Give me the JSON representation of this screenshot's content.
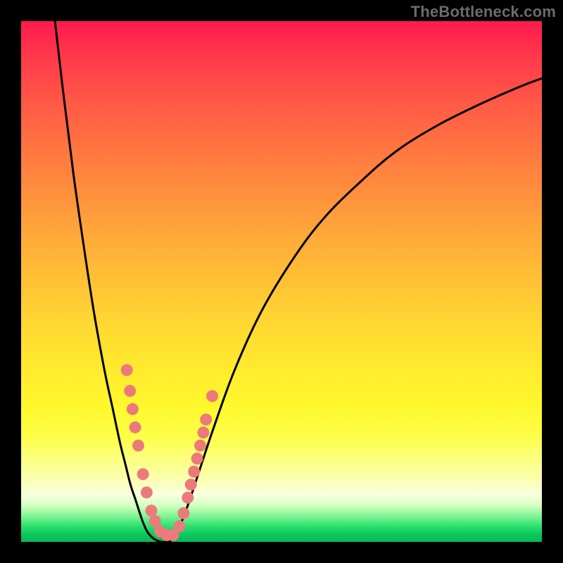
{
  "watermark": "TheBottleneck.com",
  "colors": {
    "frame": "#000000",
    "curve_stroke": "#000000",
    "marker_fill": "#ed7a7b",
    "marker_stroke": "#c95b5c",
    "gradient_top": "#ff1a4f",
    "gradient_bottom": "#07b758"
  },
  "chart_data": {
    "type": "line",
    "title": "",
    "xlabel": "",
    "ylabel": "",
    "xlim": [
      0,
      100
    ],
    "ylim": [
      0,
      100
    ],
    "grid": false,
    "legend": false,
    "series": [
      {
        "name": "bottleneck-curve-left",
        "x": [
          6.5,
          8,
          10,
          12,
          14,
          16,
          17.5,
          19,
          20,
          21,
          22,
          22.8,
          23.5,
          24.2,
          25,
          26,
          27,
          28.5
        ],
        "y": [
          100,
          87,
          71,
          57,
          44,
          33,
          26,
          19,
          15,
          11,
          8,
          5.5,
          3.5,
          2,
          1,
          0.3,
          0,
          0
        ]
      },
      {
        "name": "bottleneck-curve-right",
        "x": [
          28.5,
          30,
          32,
          34,
          37,
          41,
          46,
          52,
          58,
          65,
          72,
          80,
          88,
          96,
          100
        ],
        "y": [
          0,
          2,
          7,
          13,
          22,
          33,
          44,
          54,
          62,
          69,
          75,
          80,
          84,
          87.5,
          89
        ]
      }
    ],
    "markers": [
      {
        "x": 20.3,
        "y": 33
      },
      {
        "x": 20.9,
        "y": 29
      },
      {
        "x": 21.4,
        "y": 25.5
      },
      {
        "x": 21.9,
        "y": 22
      },
      {
        "x": 22.5,
        "y": 18.5
      },
      {
        "x": 23.4,
        "y": 13
      },
      {
        "x": 24.1,
        "y": 9.5
      },
      {
        "x": 25.0,
        "y": 6
      },
      {
        "x": 25.7,
        "y": 4
      },
      {
        "x": 26.7,
        "y": 2
      },
      {
        "x": 28.0,
        "y": 1.3
      },
      {
        "x": 29.2,
        "y": 1.3
      },
      {
        "x": 30.4,
        "y": 3
      },
      {
        "x": 31.2,
        "y": 5.5
      },
      {
        "x": 32.0,
        "y": 8.5
      },
      {
        "x": 32.6,
        "y": 11
      },
      {
        "x": 33.2,
        "y": 13.5
      },
      {
        "x": 33.8,
        "y": 16
      },
      {
        "x": 34.4,
        "y": 18.5
      },
      {
        "x": 35.0,
        "y": 21
      },
      {
        "x": 35.5,
        "y": 23.5
      },
      {
        "x": 36.7,
        "y": 28
      }
    ],
    "annotations": []
  }
}
